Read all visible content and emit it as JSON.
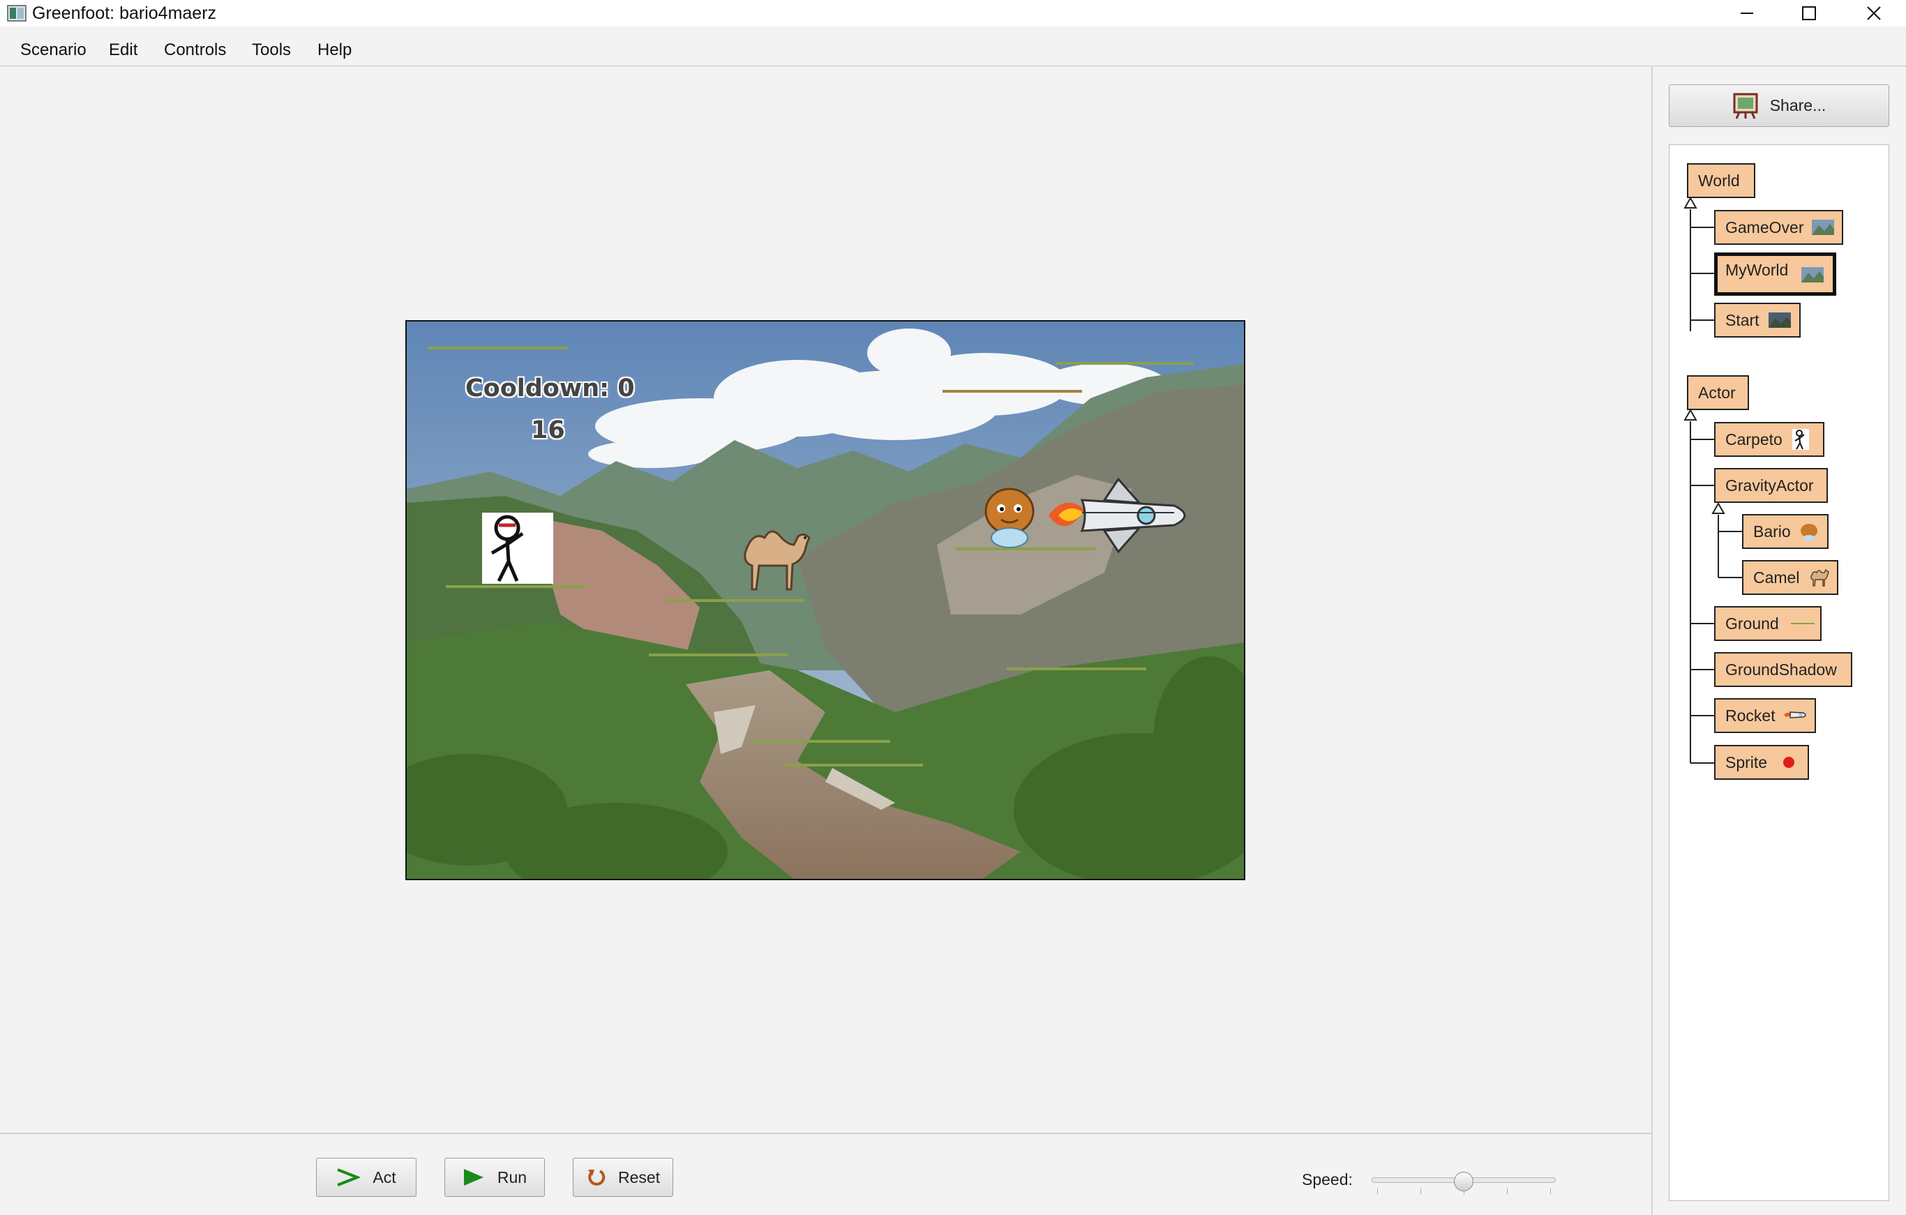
{
  "window": {
    "title": "Greenfoot: bario4maerz",
    "controls": [
      "minimize",
      "maximize",
      "close"
    ]
  },
  "menu": {
    "items": [
      "Scenario",
      "Edit",
      "Controls",
      "Tools",
      "Help"
    ]
  },
  "world": {
    "hud_cooldown": "Cooldown: 0",
    "hud_score": "16",
    "actors": [
      "carpeto",
      "camel",
      "bario",
      "rocket"
    ]
  },
  "controls": {
    "act_label": "Act",
    "run_label": "Run",
    "reset_label": "Reset",
    "speed_label": "Speed:",
    "speed_value": 0.5
  },
  "share": {
    "label": "Share..."
  },
  "classes": {
    "world_root": "World",
    "world_children": [
      "GameOver",
      "MyWorld",
      "Start"
    ],
    "selected": "MyWorld",
    "actor_root": "Actor",
    "actor_children": [
      "Carpeto",
      "GravityActor",
      "Bario",
      "Camel",
      "Ground",
      "GroundShadow",
      "Rocket",
      "Sprite"
    ]
  },
  "colors": {
    "class_box": "#f7c89b",
    "sky": "#7c9ab8",
    "ground_line": "#8aa14a"
  }
}
